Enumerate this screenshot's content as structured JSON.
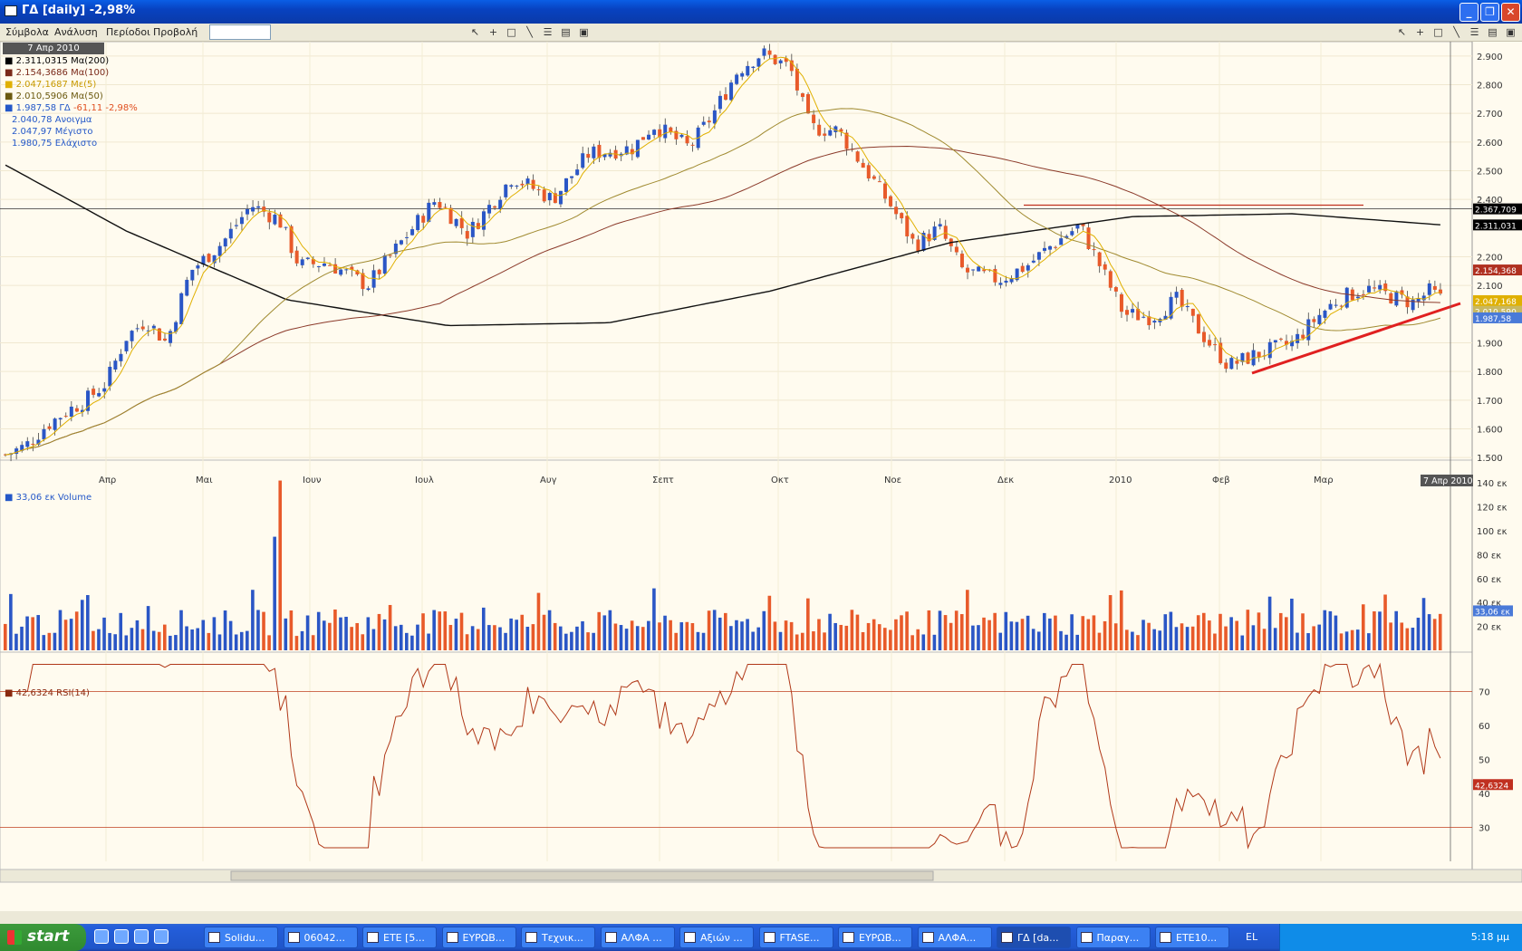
{
  "window": {
    "title": "ΓΔ [daily] -2,98%"
  },
  "menu": [
    "Σύμβολα",
    "Ανάλυση",
    "Περίοδοι",
    "Προβολή"
  ],
  "symbol_input": "",
  "price_panel": {
    "date_label": "7 Απρ 2010",
    "legend": [
      {
        "text": "2.311,0315 Μα(200)",
        "color": "#000000"
      },
      {
        "text": "2.154,3686 Μα(100)",
        "color": "#7a2a1a"
      },
      {
        "text": "2.047,1687 Με(5)",
        "color": "#e0b000"
      },
      {
        "text": "2.010,5906 Μα(50)",
        "color": "#6b5a10"
      },
      {
        "text": "1.987,58 ΓΔ",
        "color": "#2458c8"
      },
      {
        "text": "-61,11 -2,98%",
        "color": "#e05020"
      },
      {
        "text": "2.040,78 Ανοιγμα",
        "color": "#2458c8"
      },
      {
        "text": "2.047,97 Μέγιστο",
        "color": "#2458c8"
      },
      {
        "text": "1.980,75 Ελάχιστο",
        "color": "#2458c8"
      }
    ],
    "y_ticks": [
      "2.900",
      "2.800",
      "2.700",
      "2.600",
      "2.500",
      "2.400",
      "2.200",
      "2.100",
      "1.900",
      "1.800",
      "1.700",
      "1.600",
      "1.500"
    ],
    "x_ticks": [
      "Απρ",
      "Μαι",
      "Ιουν",
      "Ιουλ",
      "Αυγ",
      "Σεπτ",
      "Οκτ",
      "Νοε",
      "Δεκ",
      "2010",
      "Φεβ",
      "Μαρ"
    ],
    "tags": [
      {
        "text": "2.367,709",
        "bg": "#000000"
      },
      {
        "text": "2.311,031",
        "bg": "#000000"
      },
      {
        "text": "2.154,368",
        "bg": "#b03020"
      },
      {
        "text": "2.047,168",
        "bg": "#e0b000"
      },
      {
        "text": "2.010,590",
        "bg": "#c8b860"
      },
      {
        "text": "1.987,58",
        "bg": "#4a7ad8"
      }
    ],
    "end_date_tag": "7 Απρ 2010"
  },
  "volume_panel": {
    "legend": "33,06 εκ Volume",
    "y_ticks": [
      "140 εκ",
      "120 εκ",
      "100 εκ",
      "80 εκ",
      "60 εκ",
      "40 εκ",
      "20 εκ"
    ],
    "tag": "33,06 εκ"
  },
  "rsi_panel": {
    "legend": "42,6324 RSI(14)",
    "y_ticks": [
      "70",
      "60",
      "50",
      "40",
      "30"
    ],
    "tag": "42,6324"
  },
  "colors": {
    "up": "#2a56c6",
    "down": "#e85a2a",
    "background": "#fffbef",
    "trendline": "#e02020"
  },
  "chart_data": [
    {
      "type": "candlestick",
      "ylim": [
        1450,
        2950
      ],
      "series": [
        {
          "name": "Μα(200)",
          "values": []
        },
        {
          "name": "Μα(100)",
          "values": []
        },
        {
          "name": "Μα(50)",
          "values": []
        },
        {
          "name": "Με(5)",
          "values": []
        }
      ],
      "key_points": {
        "high": 2930,
        "low": 1500,
        "last": 1987.58
      }
    },
    {
      "type": "bar",
      "title": "Volume",
      "ylim": [
        0,
        150
      ],
      "peak": 140
    },
    {
      "type": "line",
      "title": "RSI(14)",
      "ylim": [
        20,
        80
      ],
      "levels": [
        70,
        30
      ],
      "last": 42.6324
    }
  ],
  "taskbar": {
    "start": "start",
    "tasks": [
      "Solidu...",
      "06042...",
      "ETE [5...",
      "ΕΥΡΩΒ...",
      "Τεχνικ...",
      "ΑΛΦΑ ...",
      "Αξιών ...",
      "FTASE...",
      "ΕΥΡΩΒ...",
      "ΑΛΦΑ...",
      "ΓΔ [da...",
      "Παραγ...",
      "ETE10..."
    ],
    "language": "EL",
    "clock": "5:18 μμ"
  }
}
